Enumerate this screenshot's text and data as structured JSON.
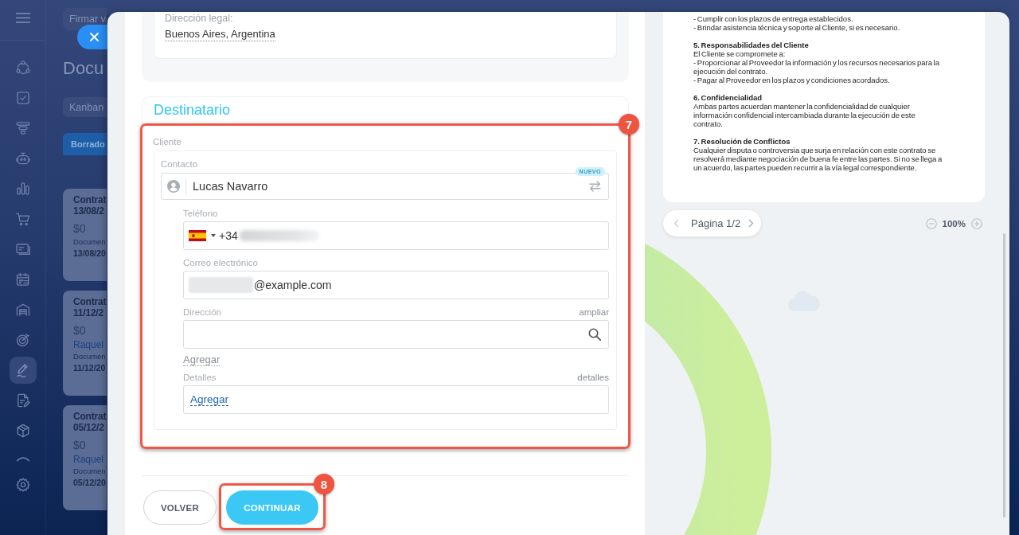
{
  "sidebar": {
    "items": [
      {
        "kind": "nodes",
        "selected": false
      },
      {
        "kind": "tasks",
        "selected": false
      },
      {
        "kind": "funnel",
        "selected": false
      },
      {
        "kind": "robot",
        "selected": false
      },
      {
        "kind": "chart",
        "selected": false
      },
      {
        "kind": "cart",
        "selected": false
      },
      {
        "kind": "card",
        "selected": false
      },
      {
        "kind": "calendar",
        "selected": false
      },
      {
        "kind": "warehouse",
        "selected": false
      },
      {
        "kind": "target",
        "selected": false
      },
      {
        "kind": "sign",
        "selected": true
      },
      {
        "kind": "document",
        "selected": false
      },
      {
        "kind": "box",
        "selected": false
      },
      {
        "kind": "arc",
        "selected": false
      },
      {
        "kind": "settings",
        "selected": false
      }
    ]
  },
  "page": {
    "search": {
      "placeholder": "Firmar v"
    },
    "title": "Docu",
    "view_switch": "Kanban",
    "column": {
      "title": "Borrado",
      "cards": [
        {
          "title": "Contrat",
          "date": "13/08/2",
          "amount": "$0",
          "doc_label": "Documen",
          "doc_date": "13/08/20"
        },
        {
          "title": "Contrat",
          "date": "11/12/2",
          "amount": "$0",
          "person": "Raquel",
          "doc_label": "Documen",
          "doc_date": "11/12/20"
        },
        {
          "title": "Contrat",
          "date": "05/12/2",
          "amount": "$0",
          "person": "Raquel",
          "doc_label": "Documen",
          "doc_date": "05/12/20"
        }
      ]
    }
  },
  "form": {
    "legal_address": {
      "label": "Dirección legal:",
      "value": "Buenos Aires, Argentina"
    },
    "recipient": {
      "title": "Destinatario",
      "callout": "7",
      "client": {
        "label": "Cliente",
        "contact": {
          "label": "Contacto",
          "value": "Lucas Navarro",
          "badge": "NUEVO"
        },
        "fields": [
          {
            "kind": "phone",
            "label": "Teléfono",
            "value": "+34",
            "redacted": true
          },
          {
            "kind": "email",
            "label": "Correo electrónico",
            "value": "@example.com",
            "redacted": true
          },
          {
            "kind": "address",
            "label": "Dirección",
            "action": "ampliar"
          },
          {
            "kind": "add_link",
            "label": "Agregar"
          },
          {
            "kind": "details",
            "label": "Detalles",
            "action": "detalles",
            "value": "Agregar"
          }
        ]
      }
    },
    "footer": {
      "buttons": [
        {
          "label": "VOLVER",
          "kind": "secondary"
        },
        {
          "label": "CONTINUAR",
          "kind": "primary",
          "callout": "8"
        }
      ]
    }
  },
  "preview": {
    "document": {
      "sections": [
        {
          "lines": [
            "- Cumplir con los plazos de entrega establecidos.",
            "- Brindar asistencia técnica y soporte al Cliente, si es necesario."
          ]
        },
        {
          "heading": "5. Responsabilidades del Cliente",
          "lines": [
            "El Cliente se compromete a:",
            "- Proporcionar al Proveedor la información y los recursos necesarios para la ejecución del contrato.",
            "- Pagar al Proveedor en los plazos y condiciones acordados."
          ]
        },
        {
          "heading": "6. Confidencialidad",
          "lines": [
            "Ambas partes acuerdan mantener la confidencialidad de cualquier información confidencial intercambiada durante la ejecución de este contrato."
          ]
        },
        {
          "heading": "7. Resolución de Conflictos",
          "lines": [
            "Cualquier disputa o controversia que surja en relación con este contrato se resolverá mediante negociación de buena fe entre las partes. Si no se llega a un acuerdo, las partes pueden recurrir a la vía legal correspondiente."
          ]
        }
      ]
    },
    "pager": {
      "label": "Página 1/2"
    },
    "zoom": {
      "value": "100%"
    }
  }
}
